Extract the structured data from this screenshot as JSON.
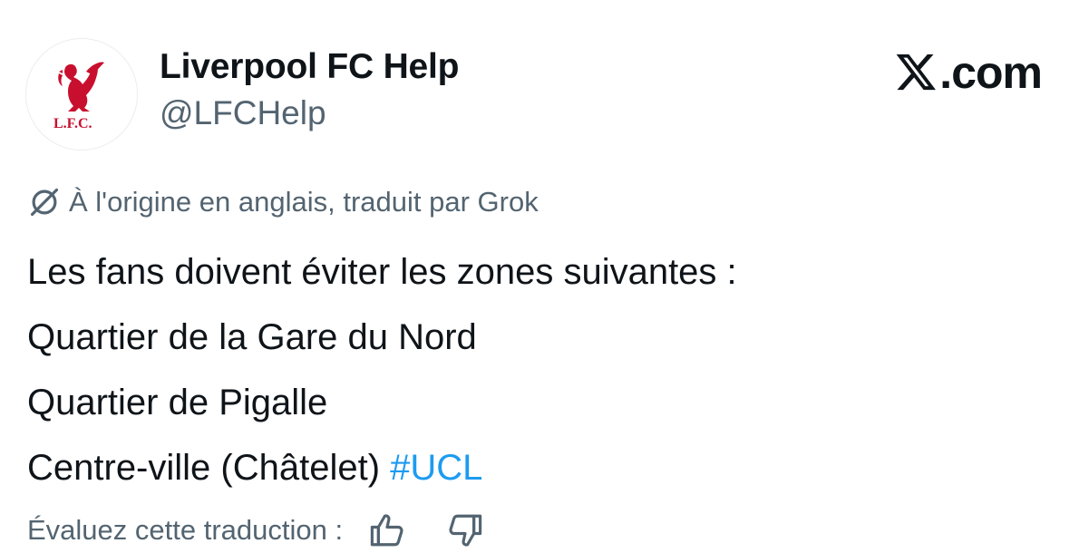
{
  "account": {
    "display_name": "Liverpool FC Help",
    "handle": "@LFCHelp",
    "avatar_icon": "liverbird-crest-icon",
    "avatar_text": "L.F.C.",
    "brand_color": "#c8102e"
  },
  "brand": {
    "logo_icon": "x-logo-icon",
    "domain": ".com"
  },
  "translation": {
    "icon": "translate-icon",
    "note": "À l'origine en anglais, traduit par Grok"
  },
  "tweet": {
    "lines": [
      "Les fans doivent éviter les zones suivantes :",
      "Quartier de la Gare du Nord",
      "Quartier de Pigalle",
      "Centre-ville (Châtelet)"
    ],
    "hashtag": "#UCL",
    "hashtag_color": "#1d9bf0"
  },
  "rating": {
    "label": "Évaluez cette traduction :",
    "thumbs_up_icon": "thumbs-up-icon",
    "thumbs_down_icon": "thumbs-down-icon"
  }
}
